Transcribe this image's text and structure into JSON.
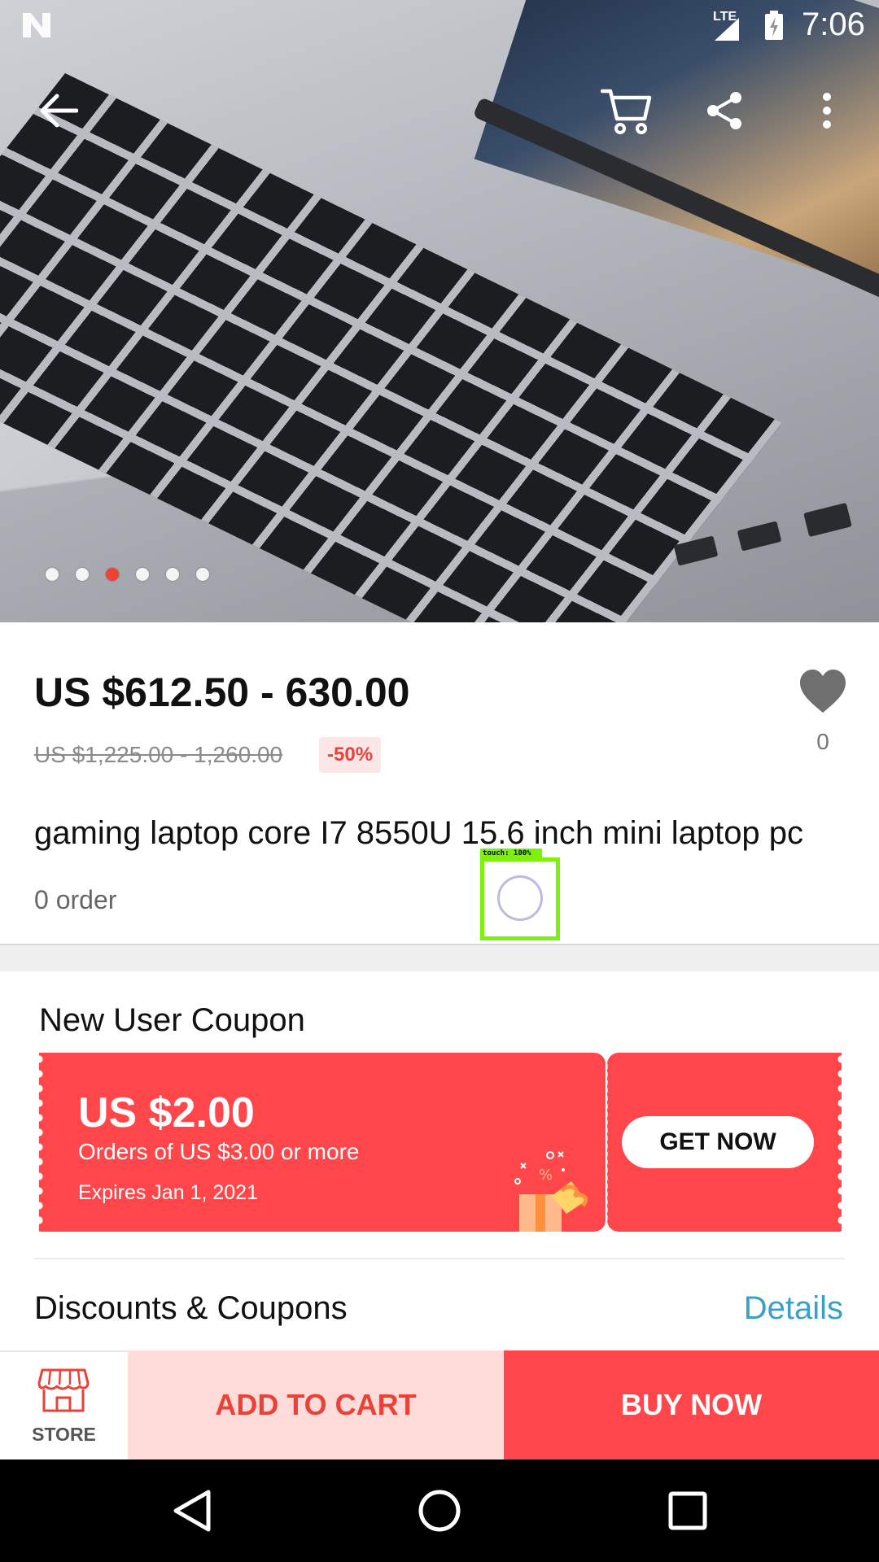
{
  "status_bar": {
    "network": "LTE",
    "time": "7:06"
  },
  "toolbar": {
    "back_icon": "arrow-left-icon",
    "cart_icon": "shopping-cart-icon",
    "share_icon": "share-icon",
    "more_icon": "more-vertical-icon"
  },
  "gallery": {
    "image_count": 6,
    "active_index": 2,
    "active_color": "#ef4135"
  },
  "product": {
    "price": "US $612.50 - 630.00",
    "original_price": "US $1,225.00 - 1,260.00",
    "discount": "-50%",
    "wishlist_count": "0",
    "title": "gaming laptop core I7 8550U 15.6 inch mini laptop pc",
    "orders": "0 order"
  },
  "coupon": {
    "heading": "New User Coupon",
    "amount": "US $2.00",
    "condition": "Orders of US $3.00 or more",
    "expiry": "Expires Jan 1, 2021",
    "button": "GET NOW",
    "color": "#ff474b"
  },
  "discounts": {
    "label": "Discounts & Coupons",
    "details": "Details",
    "details_color": "#3aa0c9"
  },
  "action_bar": {
    "store": "STORE",
    "add_to_cart": "ADD TO CART",
    "buy_now": "BUY NOW"
  },
  "touch_overlay": {
    "label": "touch: 100%"
  }
}
